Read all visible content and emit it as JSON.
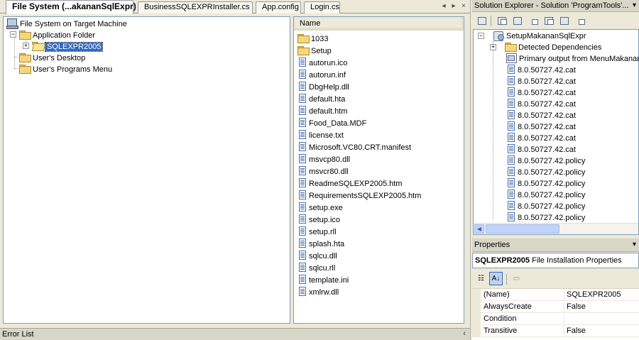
{
  "tabs": [
    {
      "label": "File System (...akananSqlExpr)",
      "active": true
    },
    {
      "label": "BusinessSQLEXPRInstaller.cs",
      "active": false
    },
    {
      "label": "App.config",
      "active": false
    },
    {
      "label": "Login.cs",
      "active": false
    }
  ],
  "tab_controls": {
    "scroll_left": "◂",
    "scroll_right": "▸",
    "close": "×"
  },
  "fs_tree": {
    "root": "File System on Target Machine",
    "application_folder": "Application Folder",
    "selected_folder": "SQLEXPR2005",
    "users_desktop": "User's Desktop",
    "users_programs_menu": "User's Programs Menu",
    "expander_plus": "+",
    "expander_minus": "−"
  },
  "file_list": {
    "column_name": "Name",
    "folders": [
      "1033",
      "Setup"
    ],
    "files": [
      "autorun.ico",
      "autorun.inf",
      "DbgHelp.dll",
      "default.hta",
      "default.htm",
      "Food_Data.MDF",
      "license.txt",
      "Microsoft.VC80.CRT.manifest",
      "msvcp80.dll",
      "msvcr80.dll",
      "ReadmeSQLEXP2005.htm",
      "RequirementsSQLEXP2005.htm",
      "setup.exe",
      "setup.ico",
      "setup.rll",
      "splash.hta",
      "sqlcu.dll",
      "sqlcu.rll",
      "template.ini",
      "xmlrw.dll"
    ]
  },
  "error_list": {
    "title": "Error List",
    "pin": "‹"
  },
  "solution_explorer": {
    "title": "Solution Explorer - Solution 'ProgramTools'...",
    "dropdown": "▾",
    "project": "SetupMakananSqlExpr",
    "detected_dependencies": "Detected Dependencies",
    "primary_output": "Primary output from MenuMakanan",
    "items": [
      "8.0.50727.42.cat",
      "8.0.50727.42.cat",
      "8.0.50727.42.cat",
      "8.0.50727.42.cat",
      "8.0.50727.42.cat",
      "8.0.50727.42.cat",
      "8.0.50727.42.cat",
      "8.0.50727.42.cat",
      "8.0.50727.42.policy",
      "8.0.50727.42.policy",
      "8.0.50727.42.policy",
      "8.0.50727.42.policy",
      "8.0.50727.42.policy",
      "8.0.50727.42.policy"
    ],
    "scroll_left": "◀"
  },
  "properties": {
    "title": "Properties",
    "dropdown": "▾",
    "object_name": "SQLEXPR2005",
    "object_type": "File Installation Properties",
    "rows": [
      {
        "name": "(Name)",
        "value": "SQLEXPR2005"
      },
      {
        "name": "AlwaysCreate",
        "value": "False"
      },
      {
        "name": "Condition",
        "value": ""
      },
      {
        "name": "Transitive",
        "value": "False"
      }
    ],
    "toolbar": {
      "categorized": "☷",
      "alphabetical": "A↓",
      "property_pages": "▭"
    }
  }
}
